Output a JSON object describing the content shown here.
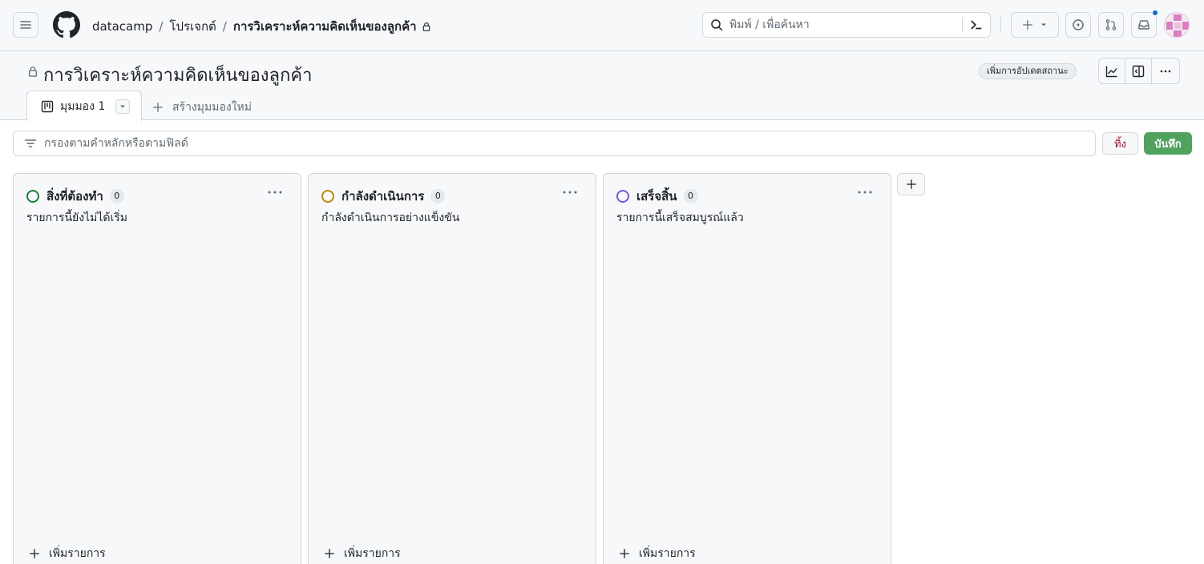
{
  "header": {
    "breadcrumb": {
      "org": "datacamp",
      "section": "โปรเจกต์",
      "project": "การวิเคราะห์ความคิดเห็นของลูกค้า",
      "separator": "/"
    },
    "search": {
      "placeholder": "พิมพ์ / เพื่อค้นหา"
    },
    "colors": {
      "notification_dot": "#0969da"
    }
  },
  "project": {
    "title": "การวิเคราะห์ความคิดเห็นของลูกค้า",
    "status_update_label": "เพิ่มการอัปเดตสถานะ",
    "tabs": [
      {
        "label": "มุมมอง 1"
      }
    ],
    "new_view_label": "สร้างมุมมองใหม่"
  },
  "filter": {
    "placeholder": "กรองตามคำหลักหรือตามฟิลด์",
    "discard_label": "ทิ้ง",
    "save_label": "บันทึก",
    "colors": {
      "discard_text": "#a40e26",
      "save_bg": "#4fa35d"
    }
  },
  "columns": [
    {
      "name": "สิ่งที่ต้องทำ",
      "count": "0",
      "description": "รายการนี้ยังไม่ได้เริ่ม",
      "add_label": "เพิ่มรายการ",
      "color": "#1a7f37"
    },
    {
      "name": "กำลังดำเนินการ",
      "count": "0",
      "description": "กำลังดำเนินการอย่างแข็งขัน",
      "add_label": "เพิ่มรายการ",
      "color": "#bf8700"
    },
    {
      "name": "เสร็จสิ้น",
      "count": "0",
      "description": "รายการนี้เสร็จสมบูรณ์แล้ว",
      "add_label": "เพิ่มรายการ",
      "color": "#8250df"
    }
  ]
}
